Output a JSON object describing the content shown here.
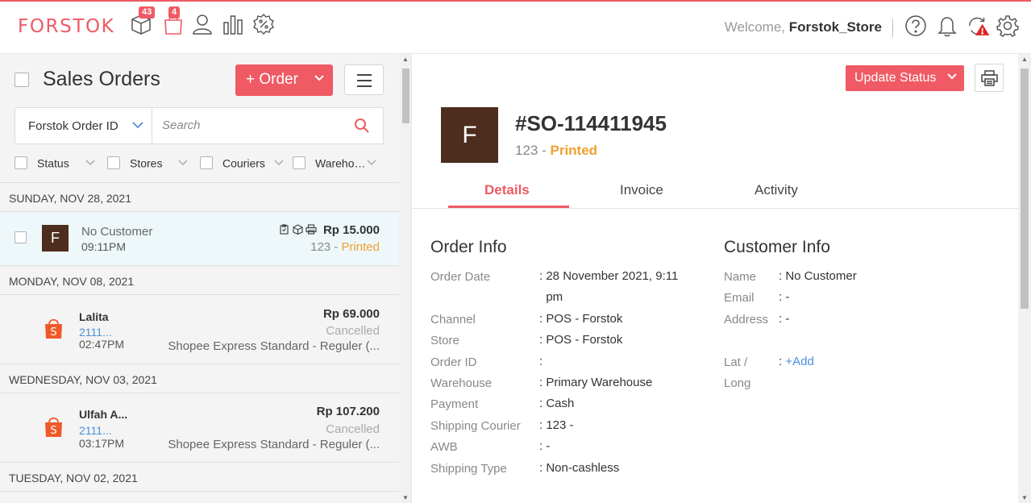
{
  "brand": "FORSTOK",
  "badges": {
    "inventory": "43",
    "orders": "4"
  },
  "header": {
    "welcome": "Welcome,",
    "user": "Forstok_Store"
  },
  "left": {
    "title": "Sales Orders",
    "order_button": "+ Order",
    "search_field": "Forstok Order ID",
    "search_placeholder": "Search",
    "filters": [
      "Status",
      "Stores",
      "Couriers",
      "Wareho…"
    ],
    "groups": [
      {
        "date": "SUNDAY, NOV 28, 2021"
      },
      {
        "date": "MONDAY, NOV 08, 2021"
      },
      {
        "date": "WEDNESDAY, NOV 03, 2021"
      },
      {
        "date": "TUESDAY, NOV 02, 2021"
      }
    ],
    "orders": [
      {
        "avatar": "F",
        "name": "No Customer",
        "time": "09:11PM",
        "amount": "Rp 15.000",
        "ref": "123 - ",
        "status": "Printed"
      },
      {
        "name": "Lalita",
        "id": "2111...",
        "time": "02:47PM",
        "amount": "Rp 69.000",
        "status": "Cancelled",
        "shipping": "Shopee Express Standard - Reguler (..."
      },
      {
        "name": "Ulfah A...",
        "id": "2111...",
        "time": "03:17PM",
        "amount": "Rp 107.200",
        "status": "Cancelled",
        "shipping": "Shopee Express Standard - Reguler (..."
      }
    ]
  },
  "detail": {
    "update_status": "Update Status",
    "avatar": "F",
    "so_number": "#SO-114411945",
    "ref": "123 - ",
    "status": "Printed",
    "tabs": [
      "Details",
      "Invoice",
      "Activity"
    ],
    "order_info_title": "Order Info",
    "order_info": [
      {
        "label": "Order Date",
        "value": "28 November 2021, 9:11",
        "value2": "pm"
      },
      {
        "label": "Channel",
        "value": "POS - Forstok"
      },
      {
        "label": "Store",
        "value": "POS - Forstok"
      },
      {
        "label": "Order ID",
        "value": ""
      },
      {
        "label": "Warehouse",
        "value": "Primary Warehouse"
      },
      {
        "label": "Payment",
        "value": "Cash"
      },
      {
        "label": "Shipping Courier",
        "value": "123 -"
      },
      {
        "label": "AWB",
        "value": "-"
      },
      {
        "label": "Shipping Type",
        "value": "Non-cashless"
      }
    ],
    "customer_info_title": "Customer Info",
    "customer_info": [
      {
        "label": "Name",
        "value": "No Customer"
      },
      {
        "label": "Email",
        "value": "-"
      },
      {
        "label": "Address",
        "value": "-"
      },
      {
        "label": "Lat /",
        "label2": "Long",
        "value": "+Add"
      }
    ]
  },
  "colors": {
    "accent": "#ef5a64",
    "printed": "#f0a030",
    "link": "#4a90d9",
    "avatar": "#4d2d1e"
  }
}
